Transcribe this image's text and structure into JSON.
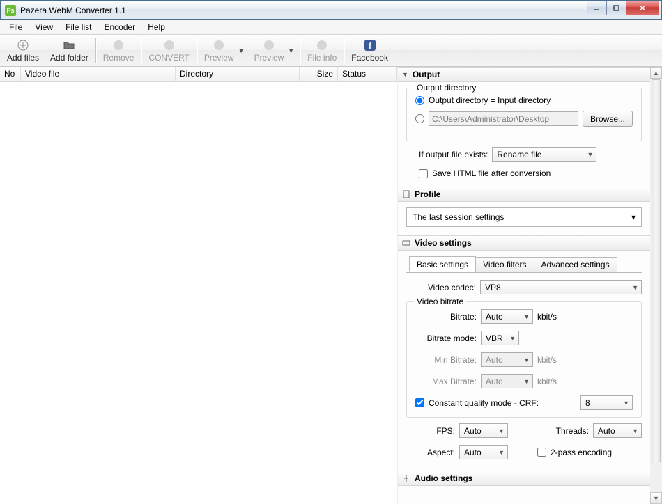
{
  "window": {
    "title": "Pazera WebM Converter 1.1",
    "icon_text": "Ps"
  },
  "menu": {
    "items": [
      "File",
      "View",
      "File list",
      "Encoder",
      "Help"
    ]
  },
  "toolbar": {
    "add_files": "Add files",
    "add_folder": "Add folder",
    "remove": "Remove",
    "convert": "CONVERT",
    "preview1": "Preview",
    "preview2": "Preview",
    "file_info": "File info",
    "facebook": "Facebook"
  },
  "list": {
    "cols": {
      "no": "No",
      "file": "Video file",
      "dir": "Directory",
      "size": "Size",
      "status": "Status"
    }
  },
  "output": {
    "title": "Output",
    "legend": "Output directory",
    "opt_same": "Output directory = Input directory",
    "path_value": "C:\\Users\\Administrator\\Desktop",
    "browse": "Browse...",
    "exists_label": "If output file exists:",
    "exists_value": "Rename file",
    "save_html": "Save HTML file after conversion"
  },
  "profile": {
    "title": "Profile",
    "value": "The last session settings"
  },
  "video": {
    "title": "Video settings",
    "tabs": {
      "basic": "Basic settings",
      "filters": "Video filters",
      "adv": "Advanced settings"
    },
    "codec_label": "Video codec:",
    "codec_value": "VP8",
    "bitrate_legend": "Video bitrate",
    "bitrate_label": "Bitrate:",
    "bitrate_value": "Auto",
    "bitrate_unit": "kbit/s",
    "mode_label": "Bitrate mode:",
    "mode_value": "VBR",
    "min_label": "Min Bitrate:",
    "min_value": "Auto",
    "max_label": "Max Bitrate:",
    "max_value": "Auto",
    "cq_label": "Constant quality mode - CRF:",
    "cq_value": "8",
    "fps_label": "FPS:",
    "fps_value": "Auto",
    "threads_label": "Threads:",
    "threads_value": "Auto",
    "aspect_label": "Aspect:",
    "aspect_value": "Auto",
    "twopass": "2-pass encoding"
  },
  "audio": {
    "title": "Audio settings"
  }
}
